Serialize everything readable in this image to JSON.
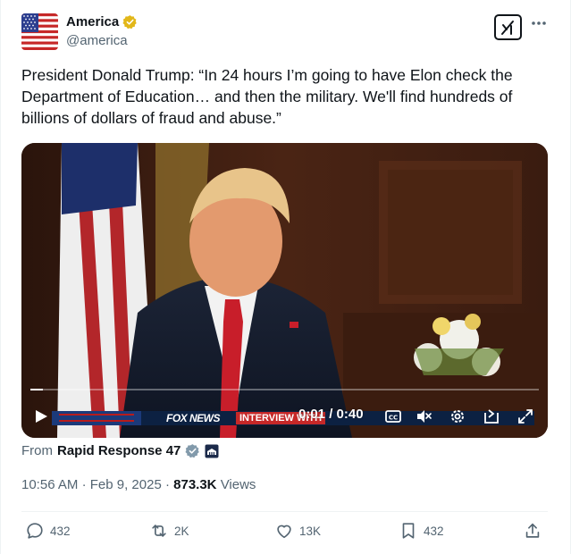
{
  "tweet": {
    "author": {
      "display_name": "America",
      "handle": "@america",
      "verified": true,
      "avatar": "us-flag-avatar"
    },
    "text": "President Donald Trump: “In 24 hours I’m going to have Elon check the Department of Education… and then the military. We'll find hundreds of billions of dollars of fraud and abuse.”",
    "media": {
      "type": "video",
      "time_readout": "0:01 / 0:40",
      "progress": 0.025,
      "ticker_logo": "FOX NEWS",
      "ticker_label": "INTERVIEW WITH"
    },
    "source": {
      "from_label": "From",
      "name": "Rapid Response 47"
    },
    "meta": {
      "time": "10:56 AM",
      "separator": "·",
      "date": "Feb 9, 2025",
      "views_count": "873.3K",
      "views_label": "Views"
    },
    "actions": {
      "replies": "432",
      "reposts": "2K",
      "likes": "13K",
      "bookmarks": "432"
    }
  },
  "colors": {
    "text_primary": "#0f1419",
    "text_secondary": "#536471",
    "verified_badge": "#e2b719",
    "source_badge": "#829aab",
    "divider": "#eff3f4"
  }
}
